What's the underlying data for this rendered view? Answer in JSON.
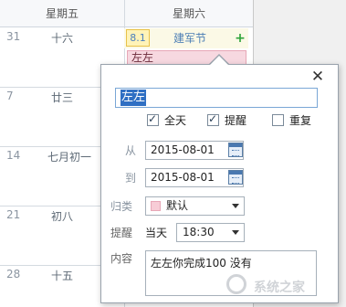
{
  "calendar": {
    "headers": [
      "星期五",
      "星期六"
    ],
    "friday_rows": [
      {
        "day": "31",
        "lunar": "十六"
      },
      {
        "day": "7",
        "lunar": "廿三"
      },
      {
        "day": "14",
        "lunar": "七月初一"
      },
      {
        "day": "21",
        "lunar": "初八"
      },
      {
        "day": "28",
        "lunar": "十五"
      }
    ],
    "saturday_first": {
      "date_badge": "8.1",
      "festival": "建军节",
      "event_title": "左左"
    }
  },
  "popup": {
    "title_value": "左左",
    "all_day_label": "全天",
    "all_day_checked": true,
    "reminder_label": "提醒",
    "reminder_checked": true,
    "repeat_label": "重复",
    "repeat_checked": false,
    "from_label": "从",
    "from_date": "2015-08-01",
    "to_label": "到",
    "to_date": "2015-08-01",
    "category_label": "归类",
    "category_value": "默认",
    "category_color": "#f7ccd6",
    "remind_label": "提醒",
    "remind_day": "当天",
    "remind_time": "18:30",
    "content_label": "内容",
    "content_value": "左左你完成100 没有"
  },
  "watermark": {
    "text": "系统之家"
  }
}
